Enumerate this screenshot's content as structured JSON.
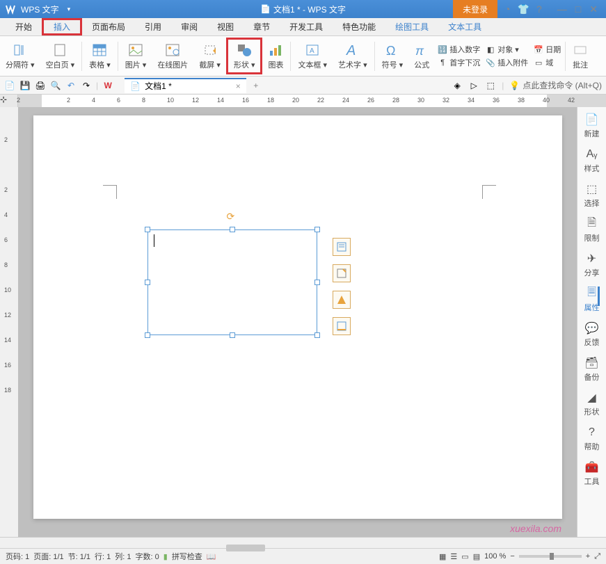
{
  "titlebar": {
    "app_name": "WPS 文字",
    "doc_title": "文档1 * - WPS 文字",
    "login": "未登录"
  },
  "tabs": {
    "start": "开始",
    "insert": "插入",
    "layout": "页面布局",
    "ref": "引用",
    "review": "审阅",
    "view": "视图",
    "chapter": "章节",
    "dev": "开发工具",
    "special": "特色功能",
    "draw": "绘图工具",
    "text": "文本工具"
  },
  "ribbon": {
    "separator": "分隔符",
    "blank": "空白页",
    "table": "表格",
    "picture": "图片",
    "online_pic": "在线图片",
    "screenshot": "截屏",
    "shapes": "形状",
    "chart": "图表",
    "textbox": "文本框",
    "wordart": "艺术字",
    "symbol": "符号",
    "formula": "公式",
    "insert_num": "插入数字",
    "dropcap": "首字下沉",
    "object": "对象",
    "attachment": "插入附件",
    "date": "日期",
    "field": "域",
    "annotate": "批注"
  },
  "qat": {
    "doc_tab": "文档1 *",
    "search_hint": "点此查找命令 (Alt+Q)"
  },
  "ruler_h": [
    "2",
    "",
    "2",
    "4",
    "6",
    "8",
    "10",
    "12",
    "14",
    "16",
    "18",
    "20",
    "22",
    "24",
    "26",
    "28",
    "30",
    "32",
    "34",
    "36",
    "38",
    "40",
    "42"
  ],
  "ruler_v": [
    "",
    "2",
    "",
    "2",
    "4",
    "6",
    "8",
    "10",
    "12",
    "14",
    "16",
    "18"
  ],
  "sidepanel": {
    "new": "新建",
    "style": "样式",
    "select": "选择",
    "limit": "限制",
    "share": "分享",
    "property": "属性",
    "feedback": "反馈",
    "backup": "备份",
    "shape": "形状",
    "help": "帮助",
    "tool": "工具"
  },
  "status": {
    "page": "页码: 1",
    "pages": "页面: 1/1",
    "section": "节: 1/1",
    "line": "行: 1",
    "col": "列: 1",
    "words": "字数: 0",
    "spell": "拼写检查",
    "zoom": "100 %"
  },
  "watermark": "xuexila.com"
}
